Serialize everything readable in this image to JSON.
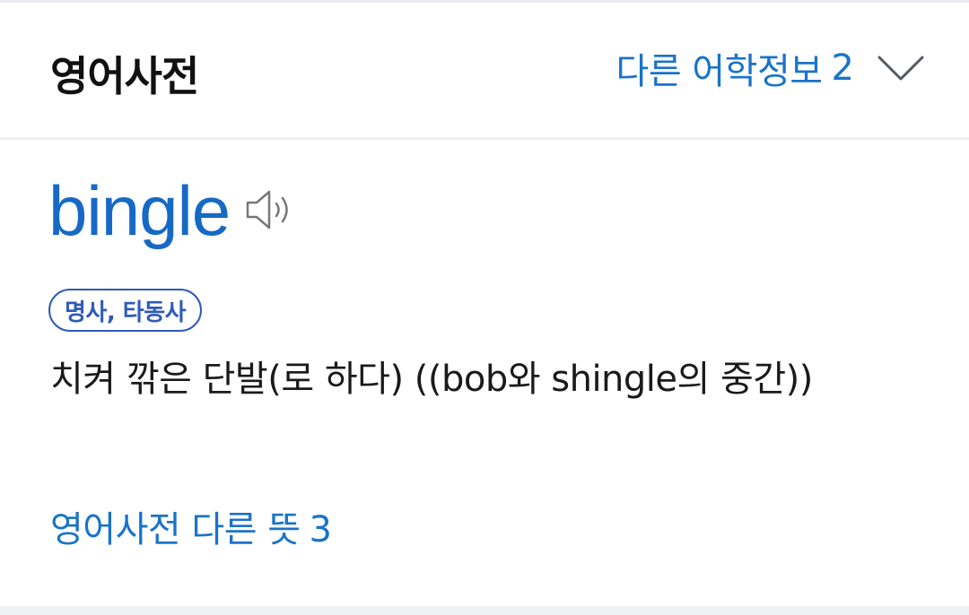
{
  "header": {
    "title": "영어사전",
    "more_info_label": "다른 어학정보",
    "more_info_count": "2",
    "chevron_icon": "chevron-down-icon"
  },
  "entry": {
    "word": "bingle",
    "audio_icon": "speaker-icon",
    "part_of_speech": "명사, 타동사",
    "definition": "치켜 깎은 단발(로 하다) ((bob와 shingle의 중간))",
    "other_meanings_label": "영어사전 다른 뜻",
    "other_meanings_count": "3"
  },
  "colors": {
    "link": "#1a73c8",
    "word": "#1669c4",
    "badge": "#2f5bb8",
    "text": "#1a1a1a"
  }
}
